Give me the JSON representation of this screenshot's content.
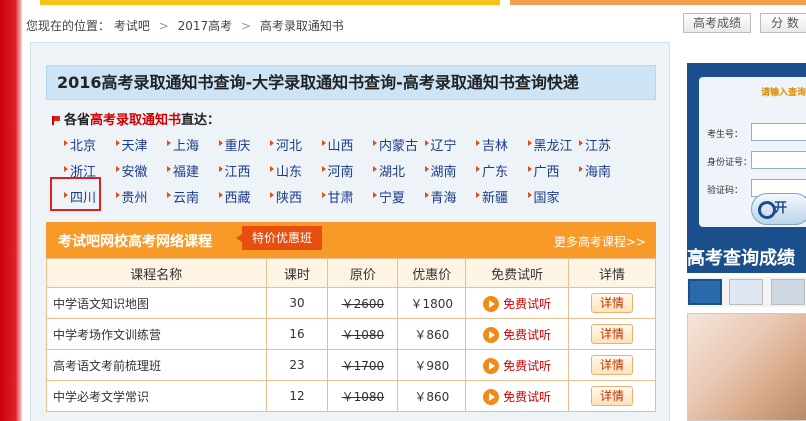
{
  "breadcrumb": {
    "prefix": "您现在的位置：",
    "items": [
      "考试吧",
      "2017高考",
      "高考录取通知书"
    ],
    "separator": ">"
  },
  "top_buttons": [
    "高考成绩",
    "分 数"
  ],
  "main_title": "2016高考录取通知书查询-大学录取通知书查询-高考录取通知书查询快递",
  "provinces": {
    "heading_prefix": "各省",
    "heading_highlight": "高考录取通知书",
    "heading_suffix": "直达：",
    "rows": [
      [
        "北京",
        "天津",
        "上海",
        "重庆",
        "河北",
        "山西",
        "内蒙古",
        "辽宁",
        "吉林",
        "黑龙江",
        "江苏"
      ],
      [
        "浙江",
        "安徽",
        "福建",
        "江西",
        "山东",
        "河南",
        "湖北",
        "湖南",
        "广东",
        "广西",
        "海南"
      ],
      [
        "四川",
        "贵州",
        "云南",
        "西藏",
        "陕西",
        "甘肃",
        "宁夏",
        "青海",
        "新疆",
        "国家"
      ]
    ]
  },
  "courses": {
    "title": "考试吧网校高考网络课程",
    "tag": "特价优惠班",
    "more": "更多高考课程>>",
    "headers": [
      "课程名称",
      "课时",
      "原价",
      "优惠价",
      "免费试听",
      "详情"
    ],
    "rows": [
      {
        "name": "中学语文知识地图",
        "hours": "30",
        "orig": "￥2600",
        "sale": "￥1800",
        "trial": "免费试听",
        "detail": "详情"
      },
      {
        "name": "中学考场作文训练营",
        "hours": "16",
        "orig": "￥1080",
        "sale": "￥860",
        "trial": "免费试听",
        "detail": "详情"
      },
      {
        "name": "高考语文考前梳理班",
        "hours": "23",
        "orig": "￥1700",
        "sale": "￥980",
        "trial": "免费试听",
        "detail": "详情"
      },
      {
        "name": "中学必考文学常识",
        "hours": "12",
        "orig": "￥1080",
        "sale": "￥860",
        "trial": "免费试听",
        "detail": "详情"
      }
    ]
  },
  "side": {
    "form_title": "请输入查询",
    "label_exam_no": "考生号：",
    "label_id_no": "身份证号：",
    "label_code": "验证码：",
    "go_button": "开",
    "banner_title": "高考查询成绩"
  },
  "colors": {
    "accent_orange": "#f89a28",
    "title_blue": "#cde4f6",
    "link_blue": "#1a3c8a",
    "highlight_red": "#d00000"
  }
}
